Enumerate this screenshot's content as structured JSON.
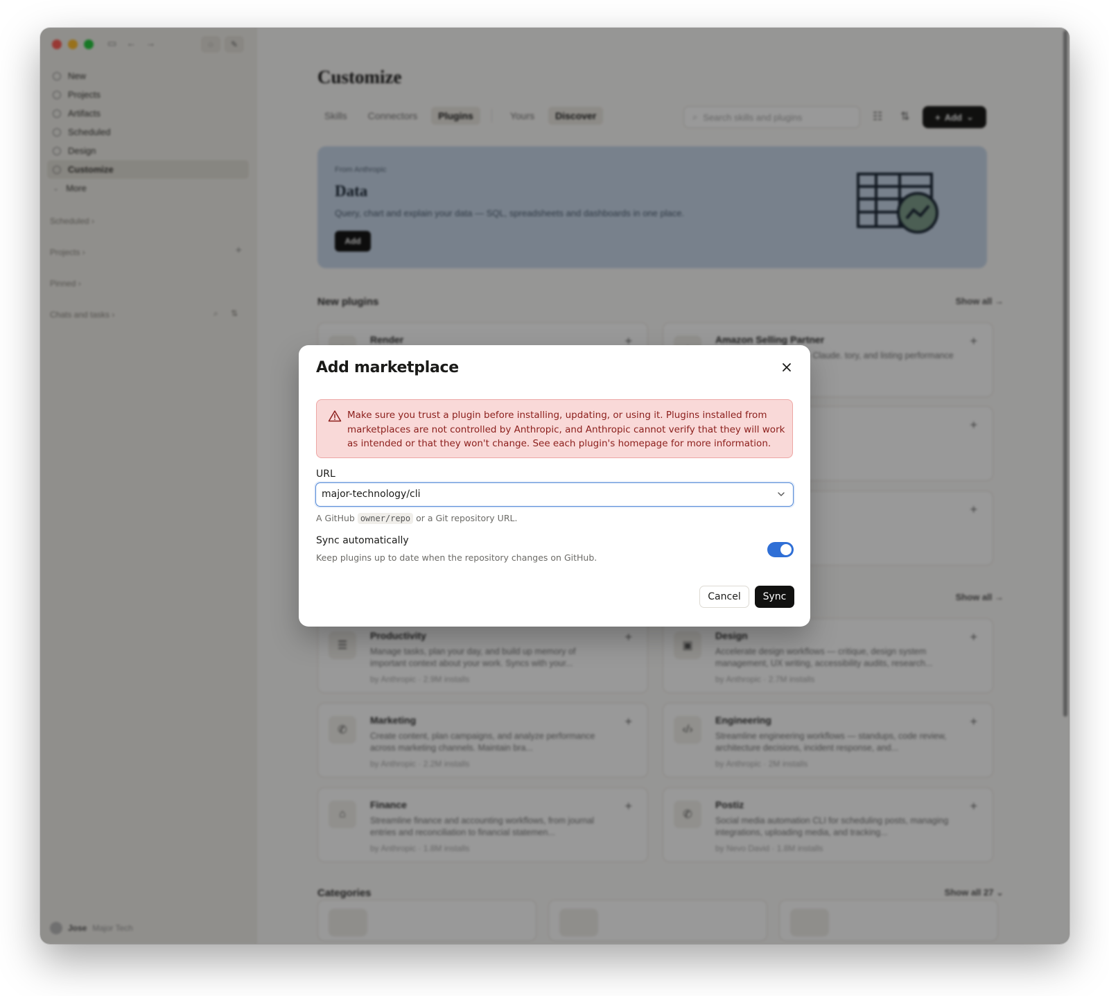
{
  "sidebar": {
    "nav": [
      {
        "label": "New",
        "icon": "plus-icon"
      },
      {
        "label": "Projects",
        "icon": "projects-icon"
      },
      {
        "label": "Artifacts",
        "icon": "artifacts-icon"
      },
      {
        "label": "Scheduled",
        "icon": "clock-icon"
      },
      {
        "label": "Design",
        "icon": "design-icon"
      },
      {
        "label": "Customize",
        "icon": "customize-icon",
        "active": true
      },
      {
        "label": "More",
        "icon": "chevron-down-icon"
      }
    ],
    "sections": {
      "scheduled": "Scheduled",
      "projects": "Projects",
      "pinned": "Pinned",
      "chats": "Chats and tasks"
    },
    "user": {
      "name": "Jose",
      "org": "Major Tech"
    }
  },
  "main": {
    "title": "Customize",
    "tabs": [
      "Skills",
      "Connectors",
      "Plugins"
    ],
    "subtabs": [
      "Yours",
      "Discover"
    ],
    "search_placeholder": "Search skills and plugins",
    "add_label": "Add",
    "hero": {
      "from": "From Anthropic",
      "title": "Data",
      "description": "Query, chart and explain your data — SQL, spreadsheets and dashboards in one place.",
      "button": "Add"
    },
    "new_plugins_heading": "New plugins",
    "show_all": "Show all",
    "new_plugins": [
      {
        "name": "Render",
        "desc": ""
      },
      {
        "name": "Amazon Selling Partner",
        "desc": "Seller Central account to Claude. tory, and listing performance an..."
      }
    ],
    "popular_plugins": [
      {
        "name": "Productivity",
        "desc": "Manage tasks, plan your day, and build up memory of important context about your work. Syncs with your...",
        "meta": "by Anthropic · 2.9M installs"
      },
      {
        "name": "Design",
        "desc": "Accelerate design workflows — critique, design system management, UX writing, accessibility audits, research...",
        "meta": "by Anthropic · 2.7M installs"
      },
      {
        "name": "Marketing",
        "desc": "Create content, plan campaigns, and analyze performance across marketing channels. Maintain bra...",
        "meta": "by Anthropic · 2.2M installs"
      },
      {
        "name": "Engineering",
        "desc": "Streamline engineering workflows — standups, code review, architecture decisions, incident response, and...",
        "meta": "by Anthropic · 2M installs"
      },
      {
        "name": "Finance",
        "desc": "Streamline finance and accounting workflows, from journal entries and reconciliation to financial statemen...",
        "meta": "by Anthropic · 1.8M installs"
      },
      {
        "name": "Postiz",
        "desc": "Social media automation CLI for scheduling posts, managing integrations, uploading media, and tracking...",
        "meta": "by Nevo David · 1.8M installs"
      }
    ],
    "categories_heading": "Categories",
    "categories_show_all": "Show all 27"
  },
  "modal": {
    "title": "Add marketplace",
    "warning": "Make sure you trust a plugin before installing, updating, or using it. Plugins installed from marketplaces are not controlled by Anthropic, and Anthropic cannot verify that they will work as intended or that they won't change. See each plugin's homepage for more information.",
    "url_label": "URL",
    "url_value": "major-technology/cli",
    "url_help_prefix": "A GitHub",
    "url_help_code": "owner/repo",
    "url_help_suffix": "or a Git repository URL.",
    "sync_label": "Sync automatically",
    "sync_desc": "Keep plugins up to date when the repository changes on GitHub.",
    "sync_enabled": true,
    "cancel": "Cancel",
    "sync": "Sync"
  },
  "colors": {
    "accent": "#2f6fd6",
    "warning_bg": "#f9d9d8",
    "warning_text": "#8b1e1b",
    "primary_button": "#111110"
  }
}
